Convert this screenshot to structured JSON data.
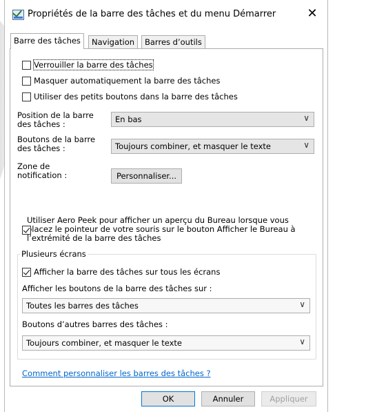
{
  "window": {
    "title": "Propriétés de la barre des tâches et du menu Démarrer",
    "close_glyph": "✕"
  },
  "tabs": [
    {
      "label": "Barre des tâches",
      "active": true
    },
    {
      "label": "Navigation",
      "active": false
    },
    {
      "label": "Barres d’outils",
      "active": false
    }
  ],
  "options": {
    "lock": {
      "label": "Verrouiller la barre des tâches",
      "checked": false
    },
    "autohide": {
      "label": "Masquer automatiquement la barre des tâches",
      "checked": false
    },
    "small_buttons": {
      "label": "Utiliser des petits boutons dans la barre des tâches",
      "checked": false
    }
  },
  "position": {
    "label_line1": "Position de la barre",
    "label_line2": "des tâches :",
    "value": "En bas"
  },
  "buttons_combine": {
    "label_line1": "Boutons de la barre",
    "label_line2": "des tâches :",
    "value": "Toujours combiner, et masquer le texte"
  },
  "notification": {
    "label_line1": "Zone de",
    "label_line2": "notification :",
    "button": "Personnaliser..."
  },
  "aero_peek": {
    "line1": "Utiliser Aero Peek pour afficher un aperçu du Bureau lorsque vous",
    "line2": "placez le pointeur de votre souris sur le bouton Afficher le Bureau à",
    "line3": "l’extrémité de la barre des tâches",
    "checked": true
  },
  "multi_screens": {
    "legend": "Plusieurs écrans",
    "show_all": {
      "label": "Afficher la barre des tâches sur tous les écrans",
      "checked": true
    },
    "show_buttons_label": "Afficher les boutons de la barre des tâches sur :",
    "show_buttons_value": "Toutes les barres des tâches",
    "other_buttons_label": "Boutons d’autres barres des tâches :",
    "other_buttons_value": "Toujours combiner, et masquer le texte"
  },
  "help_link": "Comment personnaliser les barres des tâches ?",
  "footer": {
    "ok": "OK",
    "cancel": "Annuler",
    "apply": "Appliquer"
  },
  "icons": {
    "chevron": "∨"
  }
}
